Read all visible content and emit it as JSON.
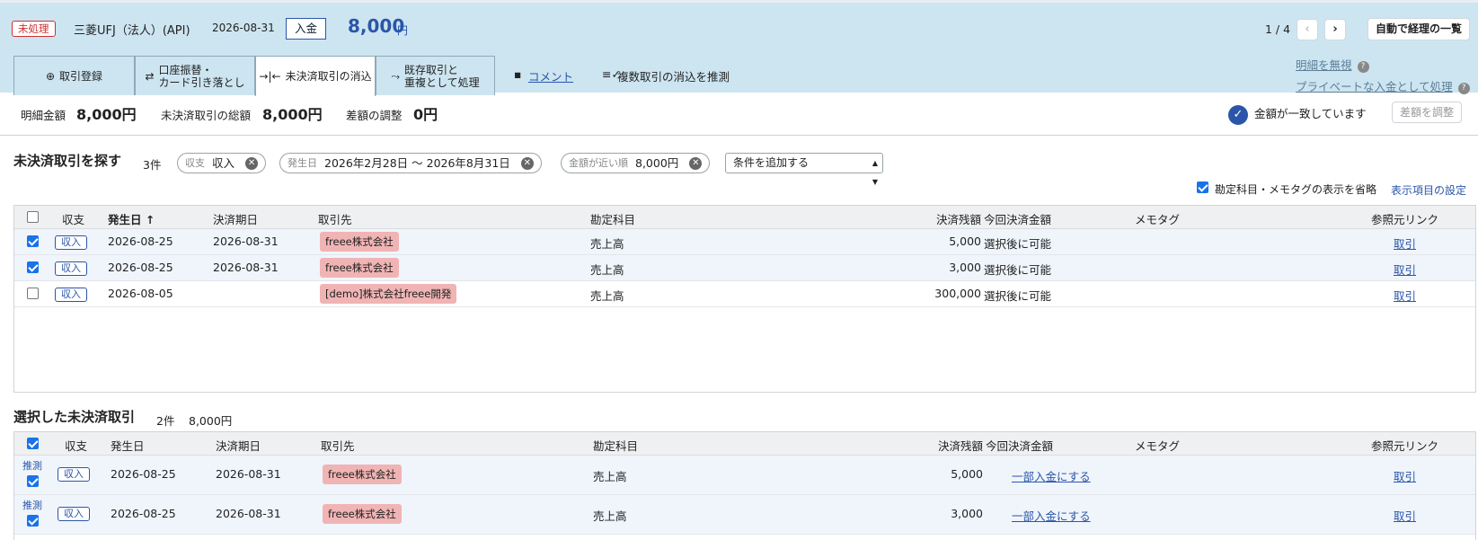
{
  "header": {
    "status_badge": "未処理",
    "bank_name": "三菱UFJ（法人）(API)",
    "date": "2026-08-31",
    "type_label": "入金",
    "amount": "8,000",
    "amount_unit": "円",
    "pager_text": "1 / 4",
    "prev_icon": "chevron-left",
    "next_icon": "chevron-right",
    "auto_button": "自動で経理の一覧"
  },
  "tabs": [
    {
      "label": "取引登録",
      "icon": "plus-circle"
    },
    {
      "label": "口座振替・\nカード引き落とし",
      "icon": "transfer-arrows"
    },
    {
      "label": "未決済取引の消込",
      "icon": "reconcile-arrows"
    },
    {
      "label": "既存取引と\n重複として処理",
      "icon": "merge-arrows"
    }
  ],
  "actions": {
    "comment": "コメント",
    "estimate_multi": "複数取引の消込を推測",
    "ignore": "明細を無視",
    "private": "プライベートな入金として処理"
  },
  "summary": {
    "detail_amount_label": "明細金額",
    "detail_amount": "8,000円",
    "unsettled_total_label": "未決済取引の総額",
    "unsettled_total": "8,000円",
    "diff_label": "差額の調整",
    "diff": "0円",
    "match_text": "金額が一致しています",
    "adjust_button": "差額を調整",
    "accent_color": "#2b56a8"
  },
  "search": {
    "title": "未決済取引を探す",
    "count": "3件",
    "chips": [
      {
        "key": "収支",
        "value": "収入"
      },
      {
        "key": "発生日",
        "value": "2026年2月28日 〜 2026年8月31日"
      },
      {
        "key": "金額が近い順",
        "value": "8,000円"
      }
    ],
    "add_condition": "条件を追加する",
    "omit_label": "勘定科目・メモタグの表示を省略",
    "display_settings": "表示項目の設定"
  },
  "table1": {
    "columns": [
      "収支",
      "発生日",
      "決済期日",
      "取引先",
      "勘定科目",
      "決済残額",
      "今回決済金額",
      "メモタグ",
      "参照元リンク"
    ],
    "sort_icon": "↑",
    "rows": [
      {
        "checked": true,
        "type": "収入",
        "date": "2026-08-25",
        "due": "2026-08-31",
        "partner": "freee株式会社",
        "account": "売上高",
        "balance": "5,000",
        "payment": "選択後に可能",
        "memo": "",
        "link": "取引"
      },
      {
        "checked": true,
        "type": "収入",
        "date": "2026-08-25",
        "due": "2026-08-31",
        "partner": "freee株式会社",
        "account": "売上高",
        "balance": "3,000",
        "payment": "選択後に可能",
        "memo": "",
        "link": "取引"
      },
      {
        "checked": false,
        "type": "収入",
        "date": "2026-08-05",
        "due": "",
        "partner": "[demo]株式会社freee開発",
        "account": "売上高",
        "balance": "300,000",
        "payment": "選択後に可能",
        "memo": "",
        "link": "取引"
      }
    ]
  },
  "selected": {
    "title": "選択した未決済取引",
    "count": "2件",
    "amount": "8,000円",
    "columns": [
      "収支",
      "発生日",
      "決済期日",
      "取引先",
      "勘定科目",
      "決済残額",
      "今回決済金額",
      "メモタグ",
      "参照元リンク"
    ],
    "rows": [
      {
        "estimate": "推測",
        "checked": true,
        "type": "収入",
        "date": "2026-08-25",
        "due": "2026-08-31",
        "partner": "freee株式会社",
        "account": "売上高",
        "balance": "5,000",
        "payment": "一部入金にする",
        "link": "取引"
      },
      {
        "estimate": "推測",
        "checked": true,
        "type": "収入",
        "date": "2026-08-25",
        "due": "2026-08-31",
        "partner": "freee株式会社",
        "account": "売上高",
        "balance": "3,000",
        "payment": "一部入金にする",
        "link": "取引"
      }
    ]
  }
}
